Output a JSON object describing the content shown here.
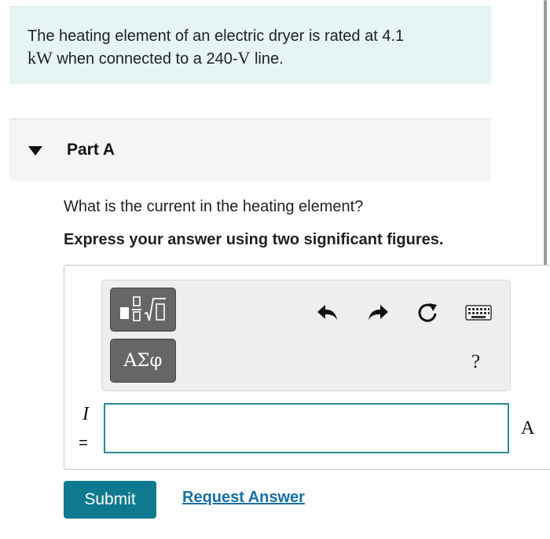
{
  "problem": {
    "text_before_unit1": "The heating element of an electric dryer is rated at 4.1",
    "unit1": "kW",
    "text_middle": " when connected to a 240-",
    "unit2": "V",
    "text_end": " line."
  },
  "part": {
    "title": "Part A",
    "question": "What is the current in the heating element?",
    "instruction": "Express your answer using two significant figures."
  },
  "toolbar": {
    "greek_button_label": "ΑΣφ",
    "help_label": "?"
  },
  "answer": {
    "variable": "I",
    "equals": "=",
    "value": "",
    "unit": "A"
  },
  "actions": {
    "submit_label": "Submit",
    "request_answer_label": "Request Answer"
  },
  "colors": {
    "accent": "#0f7a8f",
    "link": "#1570a6",
    "problem_bg": "#e6f4f4",
    "input_border": "#2a8a96"
  }
}
